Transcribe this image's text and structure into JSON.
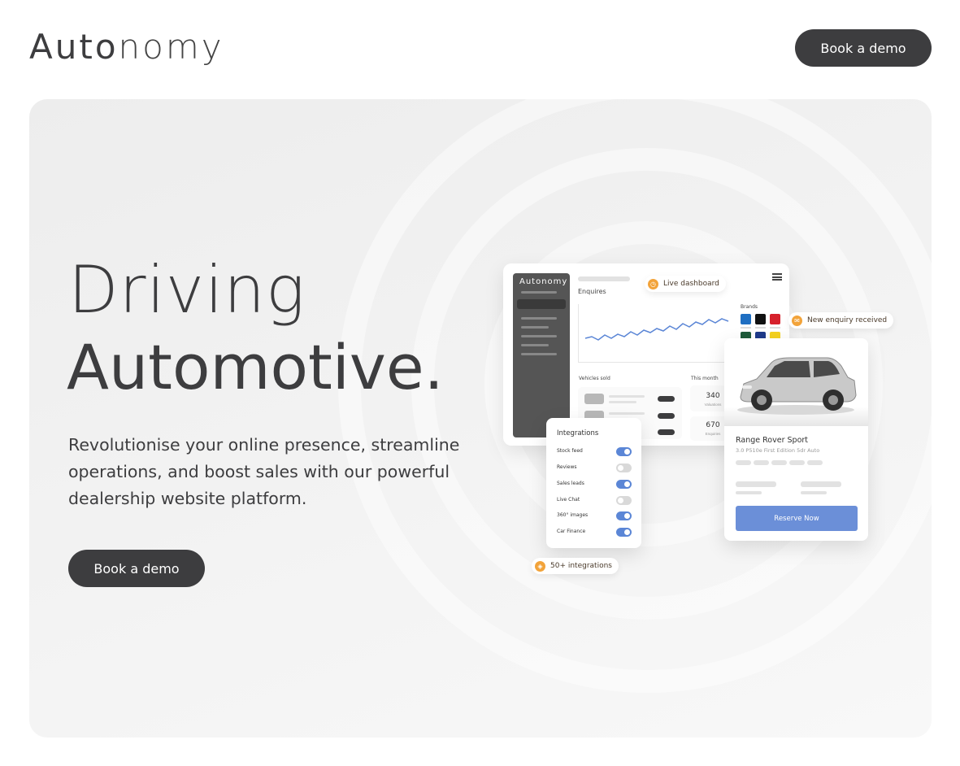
{
  "header": {
    "logo": {
      "part1": "Auto",
      "part2": "nomy"
    },
    "cta_label": "Book a demo"
  },
  "hero": {
    "headline_line1": "Driving",
    "headline_line2": "Automotive.",
    "lede": "Revolutionise your online presence, streamline operations, and boost sales with our powerful dealership website platform.",
    "cta_label": "Book a demo"
  },
  "dashboard": {
    "logo": "Autonomy",
    "enquires_label": "Enquires",
    "brands_label": "Brands",
    "vehicles_sold_label": "Vehicles sold",
    "this_month_label": "This month",
    "stat1_value": "340",
    "stat1_label": "Valuations",
    "stat2_value": "670",
    "stat2_label": "Enquiries",
    "brand_colors": [
      "#1f6fc2",
      "#111111",
      "#d6212c",
      "#1e5b3a",
      "#1e3a8a",
      "#f5d21e"
    ],
    "chart_line_color": "#5b86d6"
  },
  "chips": {
    "live_dashboard": "Live dashboard",
    "new_enquiry": "New enquiry received",
    "integrations_count": "50+ integrations"
  },
  "integrations": {
    "title": "Integrations",
    "items": [
      {
        "label": "Stock feed",
        "enabled": true
      },
      {
        "label": "Reviews",
        "enabled": false
      },
      {
        "label": "Sales leads",
        "enabled": true
      },
      {
        "label": "Live Chat",
        "enabled": false
      },
      {
        "label": "360° images",
        "enabled": true
      },
      {
        "label": "Car Finance",
        "enabled": true
      }
    ]
  },
  "car_card": {
    "name": "Range Rover Sport",
    "spec": "3.0 P510e First Edition 5dr Auto",
    "cta_label": "Reserve Now"
  },
  "colors": {
    "dark": "#3d3d3f",
    "accent_orange": "#f2a33a",
    "accent_blue": "#6b8fd8"
  }
}
